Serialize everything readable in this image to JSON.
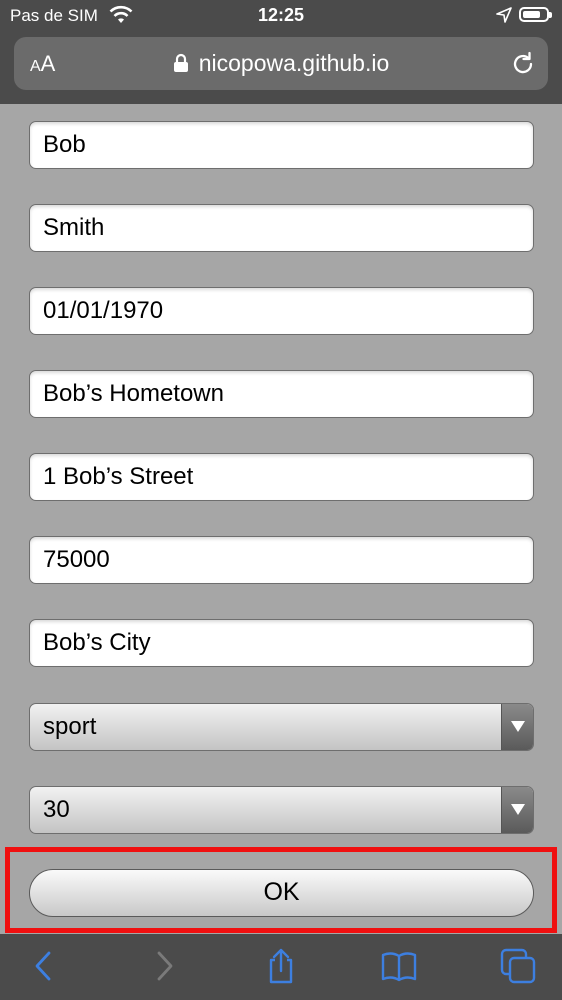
{
  "status": {
    "carrier": "Pas de SIM",
    "time": "12:25"
  },
  "browser": {
    "text_size_label_small": "A",
    "text_size_label_large": "A",
    "url": "nicopowa.github.io"
  },
  "form": {
    "first_name": "Bob",
    "last_name": "Smith",
    "birth_date": "01/01/1970",
    "hometown": "Bob’s Hometown",
    "street": "1 Bob’s Street",
    "postal_code": "75000",
    "city": "Bob’s City",
    "activity_select": "sport",
    "number_select": "30",
    "ok_label": "OK"
  },
  "toolbar": {
    "icons": [
      "back-icon",
      "forward-icon",
      "share-icon",
      "bookmarks-icon",
      "tabs-icon"
    ]
  },
  "colors": {
    "highlight": "#f01010",
    "toolbar_icon": "#3d7fe0"
  }
}
